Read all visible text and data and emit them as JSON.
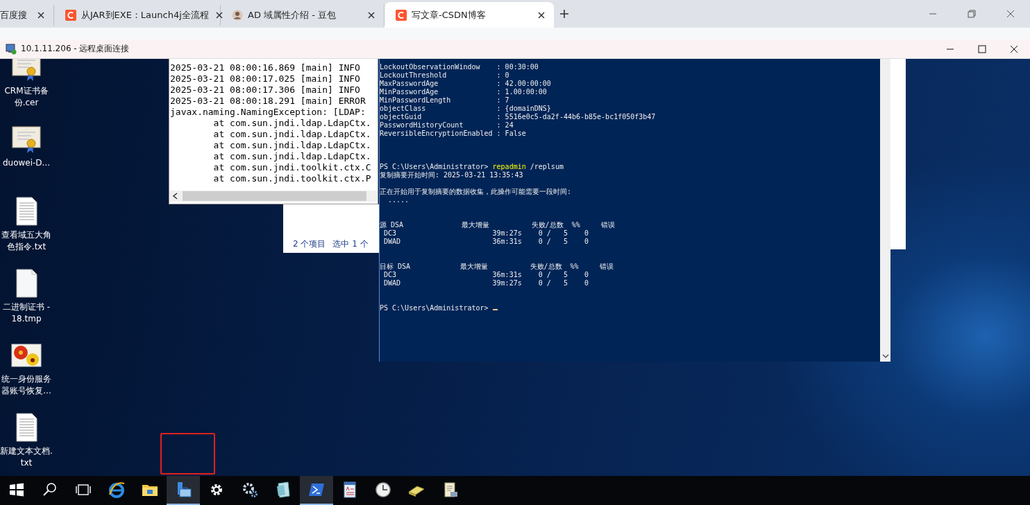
{
  "browser": {
    "tabs": [
      {
        "title": "百度搜",
        "kind": "plain",
        "selected": false
      },
      {
        "title": "从JAR到EXE：Launch4j全流程",
        "kind": "logo",
        "selected": false
      },
      {
        "title": "AD 域属性介绍 - 豆包",
        "kind": "avatar",
        "selected": false
      },
      {
        "title": "写文章-CSDN博客",
        "kind": "logo",
        "selected": true
      }
    ]
  },
  "remote_window": {
    "title": "10.1.11.206 - 远程桌面连接"
  },
  "desktop_icons": [
    {
      "kind": "certificate",
      "label": "CRM证书备份.cer"
    },
    {
      "kind": "certificate",
      "label": "duowei-D..."
    },
    {
      "kind": "text-file",
      "label": "查看域五大角色指令.txt"
    },
    {
      "kind": "blank-file",
      "label": "二进制证书 - 18.tmp"
    },
    {
      "kind": "image",
      "label": "统一身份服务器账号恢复..."
    },
    {
      "kind": "text-file",
      "label": "新建文本文档.txt"
    }
  ],
  "log_window": {
    "lines": [
      "2025-03-21 08:00:16.869 [main] INFO",
      "2025-03-21 08:00:17.025 [main] INFO",
      "2025-03-21 08:00:17.306 [main] INFO",
      "2025-03-21 08:00:18.291 [main] ERROR",
      "javax.naming.NamingException: [LDAP:",
      "        at com.sun.jndi.ldap.LdapCtx.",
      "        at com.sun.jndi.ldap.LdapCtx.",
      "        at com.sun.jndi.ldap.LdapCtx.",
      "        at com.sun.jndi.ldap.LdapCtx.",
      "        at com.sun.jndi.toolkit.ctx.C",
      "        at com.sun.jndi.toolkit.ctx.P"
    ]
  },
  "explorer_window": {
    "status": [
      "2 个项目",
      "选中 1 个"
    ]
  },
  "powershell": {
    "lines": [
      {
        "kind": "text",
        "text": "LockoutObservationWindow    : 00:30:00"
      },
      {
        "kind": "text",
        "text": "LockoutThreshold            : 0"
      },
      {
        "kind": "text",
        "text": "MaxPasswordAge              : 42.00:00:00"
      },
      {
        "kind": "text",
        "text": "MinPasswordAge              : 1.00:00:00"
      },
      {
        "kind": "text",
        "text": "MinPasswordLength           : 7"
      },
      {
        "kind": "text",
        "text": "objectClass                 : {domainDNS}"
      },
      {
        "kind": "text",
        "text": "objectGuid                  : 5516e0c5-da2f-44b6-b85e-bc1f050f3b47"
      },
      {
        "kind": "text",
        "text": "PasswordHistoryCount        : 24"
      },
      {
        "kind": "text",
        "text": "ReversibleEncryptionEnabled : False"
      },
      {
        "kind": "blank"
      },
      {
        "kind": "blank"
      },
      {
        "kind": "blank"
      },
      {
        "kind": "command",
        "prompt": "PS C:\\Users\\Administrator>",
        "command": "repadmin",
        "args": "/replsum"
      },
      {
        "kind": "text",
        "text": "复制摘要开始时间: 2025-03-21 13:35:43"
      },
      {
        "kind": "blank"
      },
      {
        "kind": "text",
        "text": "正在开始用于复制摘要的数据收集，此操作可能需要一段时间:"
      },
      {
        "kind": "text",
        "text": "  ....."
      },
      {
        "kind": "blank"
      },
      {
        "kind": "blank"
      },
      {
        "kind": "text",
        "text": "源 DSA              最大增量          失败/总数  %%     错误"
      },
      {
        "kind": "text",
        "text": " DC3                       39m:27s    0 /   5    0"
      },
      {
        "kind": "text",
        "text": " DWAD                      36m:31s    0 /   5    0"
      },
      {
        "kind": "blank"
      },
      {
        "kind": "blank"
      },
      {
        "kind": "text",
        "text": "目标 DSA            最大增量          失败/总数  %%     错误"
      },
      {
        "kind": "text",
        "text": " DC3                       36m:31s    0 /   5    0"
      },
      {
        "kind": "text",
        "text": " DWAD                      39m:27s    0 /   5    0"
      },
      {
        "kind": "blank"
      },
      {
        "kind": "blank"
      },
      {
        "kind": "prompt",
        "prompt": "PS C:\\Users\\Administrator>"
      }
    ]
  },
  "taskbar": {
    "items": [
      {
        "kind": "start",
        "active": false
      },
      {
        "kind": "search",
        "active": false
      },
      {
        "kind": "task-view",
        "active": false
      },
      {
        "kind": "browser",
        "active": false
      },
      {
        "kind": "folder",
        "active": false
      },
      {
        "kind": "server",
        "active": true
      },
      {
        "kind": "gear",
        "active": false
      },
      {
        "kind": "gears",
        "active": false
      },
      {
        "kind": "notepad",
        "active": false
      },
      {
        "kind": "powershell",
        "active": true
      },
      {
        "kind": "document-a",
        "active": false
      },
      {
        "kind": "clock",
        "active": false
      },
      {
        "kind": "scanner",
        "active": false
      },
      {
        "kind": "scroll",
        "active": false
      }
    ]
  }
}
